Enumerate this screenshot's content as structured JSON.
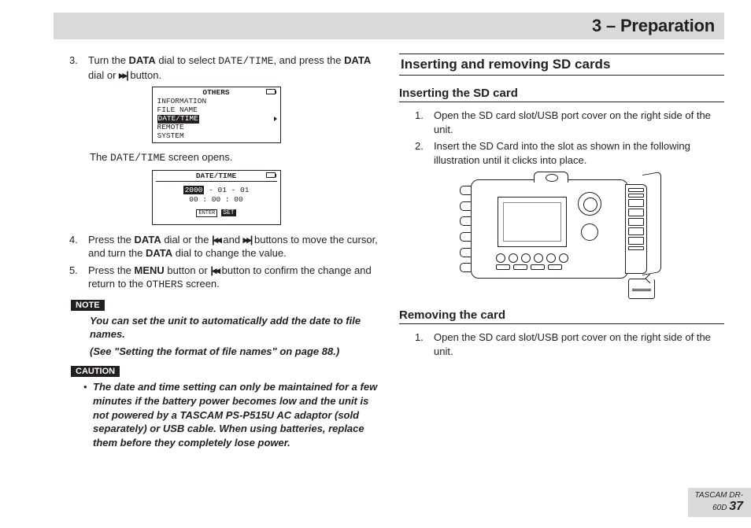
{
  "chapter": "3 – Preparation",
  "left": {
    "step3": {
      "num": "3.",
      "text_a": "Turn the ",
      "b1": "DATA",
      "text_b": " dial to select ",
      "mono1": "DATE/TIME",
      "text_c": ", and press the ",
      "b2": "DATA",
      "text_d": " dial or ",
      "text_e": " button."
    },
    "lcd1": {
      "title": "OTHERS",
      "rows": [
        "INFORMATION",
        "FILE NAME",
        "DATE/TIME",
        "REMOTE",
        "SYSTEM"
      ]
    },
    "after_lcd1_a": "The ",
    "after_lcd1_mono": "DATE/TIME",
    "after_lcd1_b": " screen opens.",
    "lcd2": {
      "title": "DATE/TIME",
      "date_inv": "2000",
      "date_rest": " - 01 - 01",
      "time": "00 : 00 : 00",
      "enter_a": "ENTER",
      "enter_b": "SET"
    },
    "step4": {
      "num": "4.",
      "text_a": "Press the ",
      "b1": "DATA",
      "text_b": " dial or the ",
      "text_c": " and ",
      "text_d": " buttons to move the cursor, and turn the ",
      "b2": "DATA",
      "text_e": " dial to change the value."
    },
    "step5": {
      "num": "5.",
      "text_a": "Press the ",
      "b1": "MENU",
      "text_b": " button or ",
      "text_c": " button to confirm the change and return to the ",
      "mono1": "OTHERS",
      "text_d": " screen."
    },
    "note_label": "NOTE",
    "note_line1": "You can set the unit to automatically add the date to file names.",
    "note_line2": "(See \"Setting the format of file names\" on page 88.)",
    "caution_label": "CAUTION",
    "caution_text": "The date and time setting can only be maintained for a few minutes if the battery power becomes low and the unit is not powered by a TASCAM PS-P515U AC adaptor (sold separately) or USB cable. When using batteries, replace them before they completely lose power."
  },
  "right": {
    "h2": "Inserting and removing SD cards",
    "h3a": "Inserting the SD card",
    "s1": {
      "num": "1.",
      "text": "Open the SD card slot/USB port cover on the right side of the unit."
    },
    "s2": {
      "num": "2.",
      "text": "Insert the SD Card into the slot as shown in the following illustration until it clicks into place."
    },
    "h3b": "Removing the card",
    "r1": {
      "num": "1.",
      "text": "Open the SD card slot/USB port cover on the right side of the unit."
    }
  },
  "footer": {
    "brand": "TASCAM  DR-60D ",
    "page": "37"
  }
}
